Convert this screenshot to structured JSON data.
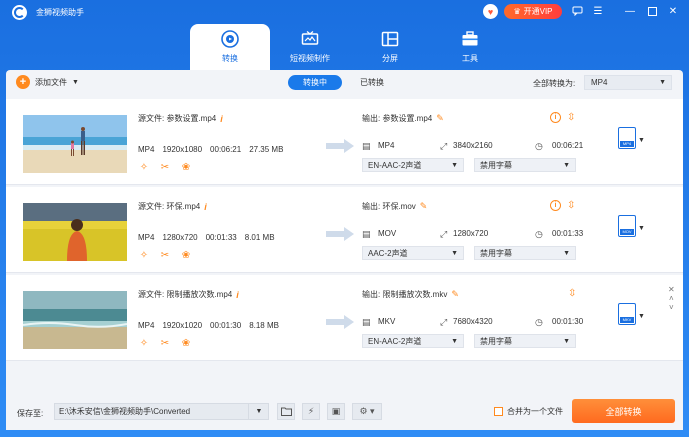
{
  "app": {
    "title": "金狮视频助手",
    "vip_label": "开通VIP"
  },
  "nav": [
    {
      "label": "转换",
      "icon": "convert-icon"
    },
    {
      "label": "短视频制作",
      "icon": "tv-icon"
    },
    {
      "label": "分屏",
      "icon": "split-screen-icon"
    },
    {
      "label": "工具",
      "icon": "toolbox-icon"
    }
  ],
  "toolbar": {
    "add_label": "添加文件",
    "converting_label": "转换中",
    "converted_label": "已转换",
    "convert_all_to_label": "全部转换为:",
    "convert_all_to_value": "MP4"
  },
  "items": [
    {
      "source": "源文件: 参数设置.mp4",
      "format": "MP4",
      "resolution": "1920x1080",
      "duration": "00:06:21",
      "size": "27.35 MB",
      "output": "输出: 参数设置.mp4",
      "out_format": "MP4",
      "out_resolution": "3840x2160",
      "out_duration": "00:06:21",
      "audio": "EN-AAC-2声道",
      "subtitle": "禁用字幕",
      "badge": "MP4"
    },
    {
      "source": "源文件: 环保.mp4",
      "format": "MP4",
      "resolution": "1280x720",
      "duration": "00:01:33",
      "size": "8.01 MB",
      "output": "输出: 环保.mov",
      "out_format": "MOV",
      "out_resolution": "1280x720",
      "out_duration": "00:01:33",
      "audio": "AAC-2声道",
      "subtitle": "禁用字幕",
      "badge": "MOV"
    },
    {
      "source": "源文件: 限制播放次数.mp4",
      "format": "MP4",
      "resolution": "1920x1020",
      "duration": "00:01:30",
      "size": "8.18 MB",
      "output": "输出: 限制播放次数.mkv",
      "out_format": "MKV",
      "out_resolution": "7680x4320",
      "out_duration": "00:01:30",
      "audio": "EN-AAC-2声道",
      "subtitle": "禁用字幕",
      "badge": "MKV"
    }
  ],
  "bottom": {
    "save_to_label": "保存至:",
    "save_path": "E:\\沐禾安信\\金狮视频助手\\Converted",
    "merge_label": "合并为一个文件",
    "convert_all_button": "全部转换"
  },
  "colors": {
    "primary": "#1a6fe0",
    "accent": "#ff8a1f"
  }
}
